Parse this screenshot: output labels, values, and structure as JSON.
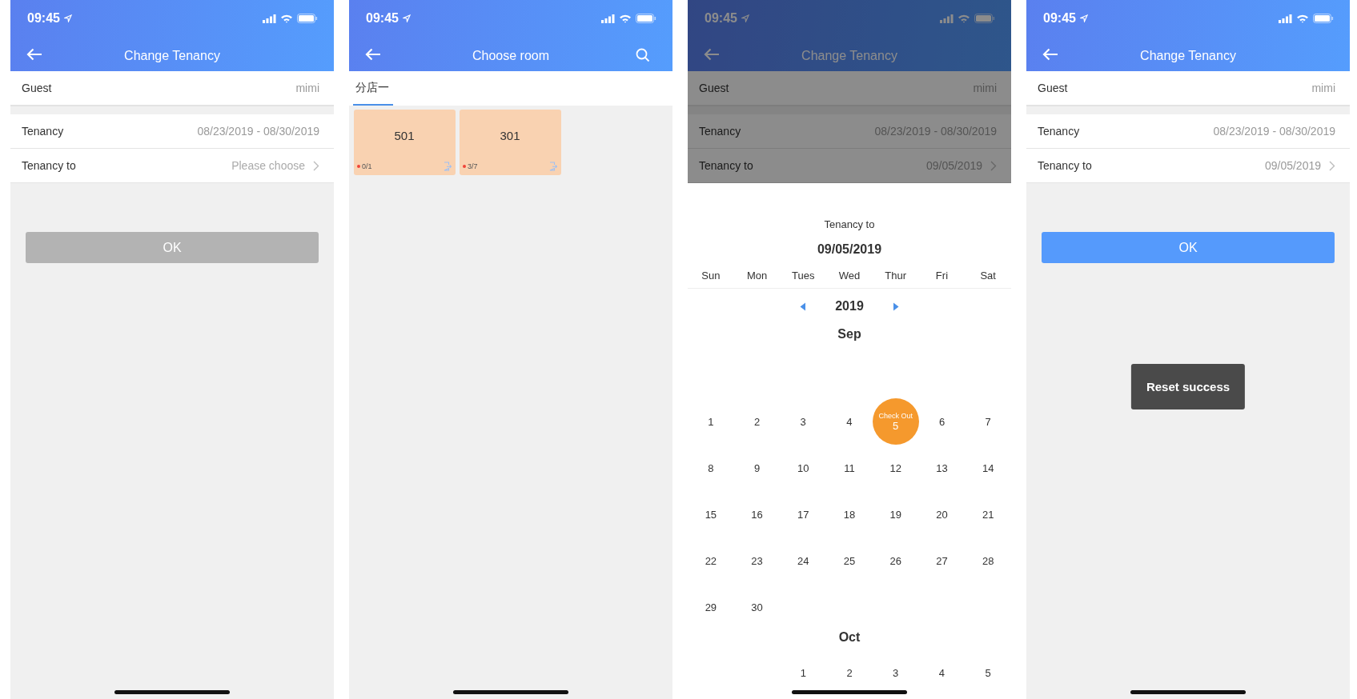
{
  "screens": [
    {
      "kind": "form",
      "status_time": "09:45",
      "title": "Change Tenancy",
      "rows": [
        {
          "label": "Guest",
          "value": "mimi",
          "chevron": false
        },
        {
          "label": "Tenancy",
          "value": "08/23/2019 - 08/30/2019",
          "chevron": false
        },
        {
          "label": "Tenancy to",
          "placeholder": "Please choose",
          "chevron": true
        }
      ],
      "button": {
        "label": "OK",
        "disabled": true
      }
    },
    {
      "kind": "room_picker",
      "status_time": "09:45",
      "title": "Choose room",
      "tabs": [
        {
          "label": "分店一",
          "selected": true
        }
      ],
      "rooms": [
        {
          "number": "501",
          "occupancy": "0/1"
        },
        {
          "number": "301",
          "occupancy": "3/7"
        }
      ]
    },
    {
      "kind": "calendar",
      "status_time": "09:45",
      "title": "Change Tenancy",
      "dimmed": true,
      "rows": [
        {
          "label": "Guest",
          "value": "mimi",
          "chevron": false
        },
        {
          "label": "Tenancy",
          "value": "08/23/2019 - 08/30/2019",
          "chevron": false
        },
        {
          "label": "Tenancy to",
          "value": "09/05/2019",
          "chevron": true
        }
      ],
      "picker": {
        "caption": "Tenancy to",
        "date": "09/05/2019",
        "weekdays": [
          "Sun",
          "Mon",
          "Tues",
          "Wed",
          "Thur",
          "Fri",
          "Sat"
        ],
        "year": "2019",
        "months": [
          {
            "name": "Sep",
            "weeks": [
              [
                {
                  "kind": "day",
                  "label": "1",
                  "selected": false
                },
                {
                  "kind": "day",
                  "label": "2",
                  "selected": false
                },
                {
                  "kind": "day",
                  "label": "3",
                  "selected": false
                },
                {
                  "kind": "day",
                  "label": "4",
                  "selected": false
                },
                {
                  "kind": "day",
                  "label": "5",
                  "selected": true,
                  "note": "Check Out"
                },
                {
                  "kind": "day",
                  "label": "6",
                  "selected": false
                },
                {
                  "kind": "day",
                  "label": "7",
                  "selected": false
                }
              ],
              [
                {
                  "kind": "day",
                  "label": "8",
                  "selected": false
                },
                {
                  "kind": "day",
                  "label": "9",
                  "selected": false
                },
                {
                  "kind": "day",
                  "label": "10",
                  "selected": false
                },
                {
                  "kind": "day",
                  "label": "11",
                  "selected": false
                },
                {
                  "kind": "day",
                  "label": "12",
                  "selected": false
                },
                {
                  "kind": "day",
                  "label": "13",
                  "selected": false
                },
                {
                  "kind": "day",
                  "label": "14",
                  "selected": false
                }
              ],
              [
                {
                  "kind": "day",
                  "label": "15",
                  "selected": false
                },
                {
                  "kind": "day",
                  "label": "16",
                  "selected": false
                },
                {
                  "kind": "day",
                  "label": "17",
                  "selected": false
                },
                {
                  "kind": "day",
                  "label": "18",
                  "selected": false
                },
                {
                  "kind": "day",
                  "label": "19",
                  "selected": false
                },
                {
                  "kind": "day",
                  "label": "20",
                  "selected": false
                },
                {
                  "kind": "day",
                  "label": "21",
                  "selected": false
                }
              ],
              [
                {
                  "kind": "day",
                  "label": "22",
                  "selected": false
                },
                {
                  "kind": "day",
                  "label": "23",
                  "selected": false
                },
                {
                  "kind": "day",
                  "label": "24",
                  "selected": false
                },
                {
                  "kind": "day",
                  "label": "25",
                  "selected": false
                },
                {
                  "kind": "day",
                  "label": "26",
                  "selected": false
                },
                {
                  "kind": "day",
                  "label": "27",
                  "selected": false
                },
                {
                  "kind": "day",
                  "label": "28",
                  "selected": false
                }
              ],
              [
                {
                  "kind": "day",
                  "label": "29",
                  "selected": false
                },
                {
                  "kind": "day",
                  "label": "30",
                  "selected": false
                }
              ]
            ]
          },
          {
            "name": "Oct",
            "weeks": [
              [
                {
                  "kind": "blank"
                },
                {
                  "kind": "blank"
                },
                {
                  "kind": "day",
                  "label": "1",
                  "selected": false
                },
                {
                  "kind": "day",
                  "label": "2",
                  "selected": false
                },
                {
                  "kind": "day",
                  "label": "3",
                  "selected": false
                },
                {
                  "kind": "day",
                  "label": "4",
                  "selected": false
                },
                {
                  "kind": "day",
                  "label": "5",
                  "selected": false
                }
              ]
            ]
          }
        ]
      }
    },
    {
      "kind": "form",
      "status_time": "09:45",
      "title": "Change Tenancy",
      "rows": [
        {
          "label": "Guest",
          "value": "mimi",
          "chevron": false
        },
        {
          "label": "Tenancy",
          "value": "08/23/2019 - 08/30/2019",
          "chevron": false
        },
        {
          "label": "Tenancy to",
          "value": "09/05/2019",
          "chevron": true
        }
      ],
      "button": {
        "label": "OK",
        "disabled": false
      },
      "toast": "Reset success"
    }
  ]
}
